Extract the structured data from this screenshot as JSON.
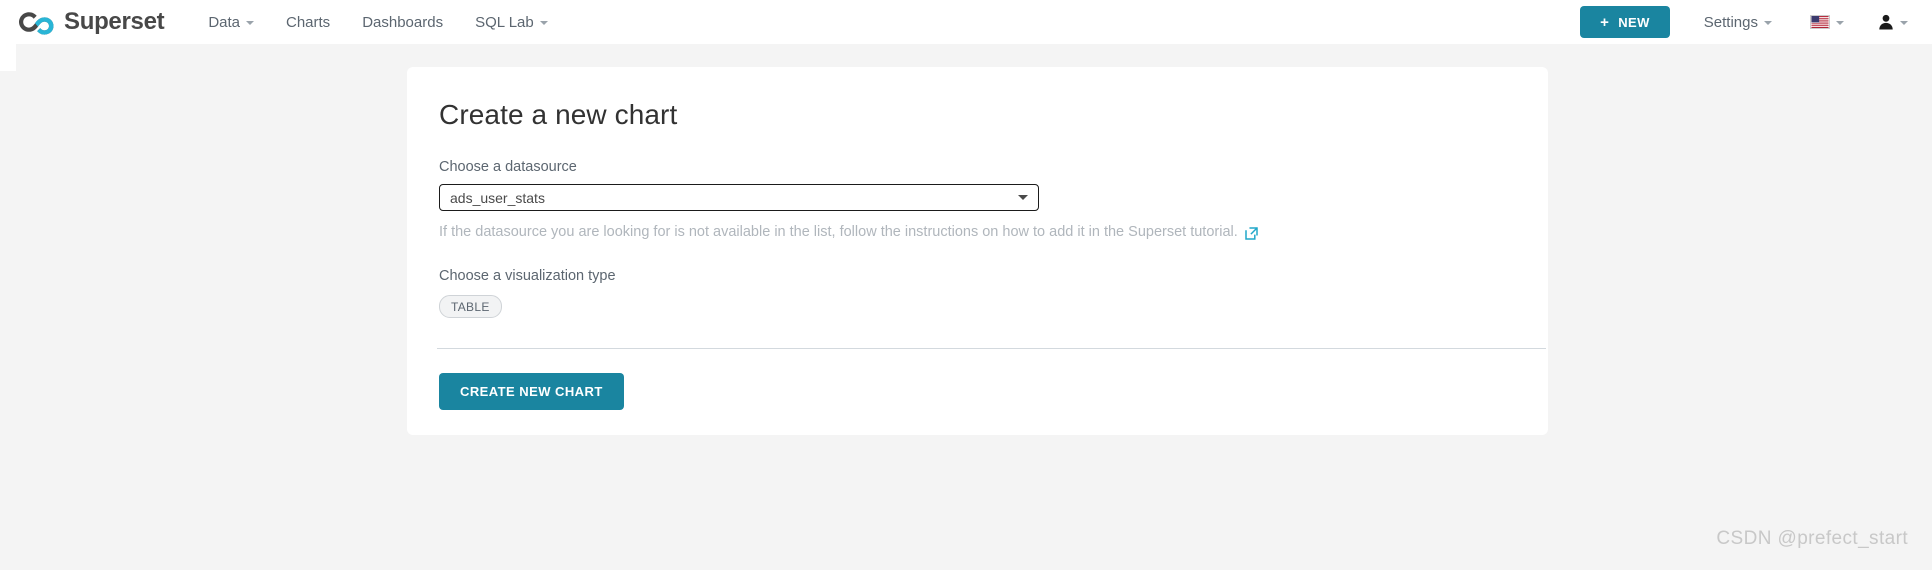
{
  "navbar": {
    "brand_name": "Superset",
    "brand_logo_icon": "superset-infinity-logo",
    "links": [
      {
        "label": "Data",
        "has_caret": true,
        "icon": "chevron-down-icon"
      },
      {
        "label": "Charts",
        "has_caret": false,
        "icon": ""
      },
      {
        "label": "Dashboards",
        "has_caret": false,
        "icon": ""
      },
      {
        "label": "SQL Lab",
        "has_caret": true,
        "icon": "chevron-down-icon"
      }
    ],
    "new_button": {
      "label": "NEW",
      "plus": "+",
      "icon": "plus-icon"
    },
    "settings": {
      "label": "Settings",
      "icon": "chevron-down-icon"
    },
    "language": {
      "icon": "us-flag-icon",
      "caret_icon": "chevron-down-icon"
    },
    "user": {
      "icon": "user-icon",
      "caret_icon": "chevron-down-icon"
    }
  },
  "card": {
    "title": "Create a new chart",
    "datasource": {
      "label": "Choose a datasource",
      "value": "ads_user_stats",
      "placeholder": "Choose a datasource",
      "caret_icon": "chevron-down-icon"
    },
    "helper": {
      "text": "If the datasource you are looking for is not available in the list, follow the instructions on how to add it in the Superset tutorial.",
      "link_icon": "external-link-icon"
    },
    "visualization": {
      "label": "Choose a visualization type",
      "selected": "TABLE"
    },
    "submit_button": {
      "label": "CREATE NEW CHART"
    }
  },
  "watermark": {
    "text": "CSDN @prefect_start"
  },
  "colors": {
    "accent_teal": "#1a85a0",
    "logo_cyan": "#29b5d6",
    "logo_dark": "#484848",
    "page_bg": "#f4f4f4",
    "card_bg": "#ffffff",
    "helper_text": "#b0b6bc",
    "divider": "#d3d9de"
  }
}
